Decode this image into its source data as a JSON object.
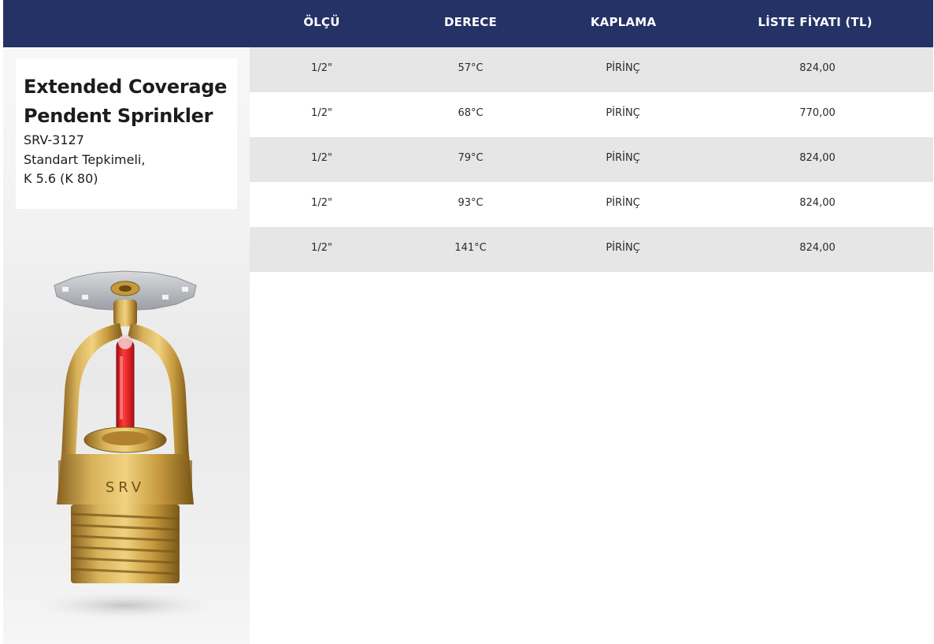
{
  "table": {
    "headers": [
      "ÖLÇÜ",
      "DERECE",
      "KAPLAMA",
      "LİSTE FİYATI (TL)"
    ],
    "rows": [
      {
        "size": "1/2\"",
        "degree": "57°C",
        "coating": "PİRİNÇ",
        "price": "824,00"
      },
      {
        "size": "1/2\"",
        "degree": "68°C",
        "coating": "PİRİNÇ",
        "price": "770,00"
      },
      {
        "size": "1/2\"",
        "degree": "79°C",
        "coating": "PİRİNÇ",
        "price": "824,00"
      },
      {
        "size": "1/2\"",
        "degree": "93°C",
        "coating": "PİRİNÇ",
        "price": "824,00"
      },
      {
        "size": "1/2\"",
        "degree": "141°C",
        "coating": "PİRİNÇ",
        "price": "824,00"
      }
    ]
  },
  "product": {
    "title_line1": "Extended Coverage",
    "title_line2": "Pendent Sprinkler",
    "code": "SRV-3127",
    "response": "Standart Tepkimeli,",
    "k_factor": "K 5.6 (K 80)",
    "body_stamp": "SRV"
  },
  "colors": {
    "header_bg": "#243266",
    "row_shade": "#e6e6e6",
    "brass": "#c9a043",
    "bulb_red": "#e0161c"
  },
  "icons": {
    "product_image": "pendent-sprinkler-image"
  }
}
